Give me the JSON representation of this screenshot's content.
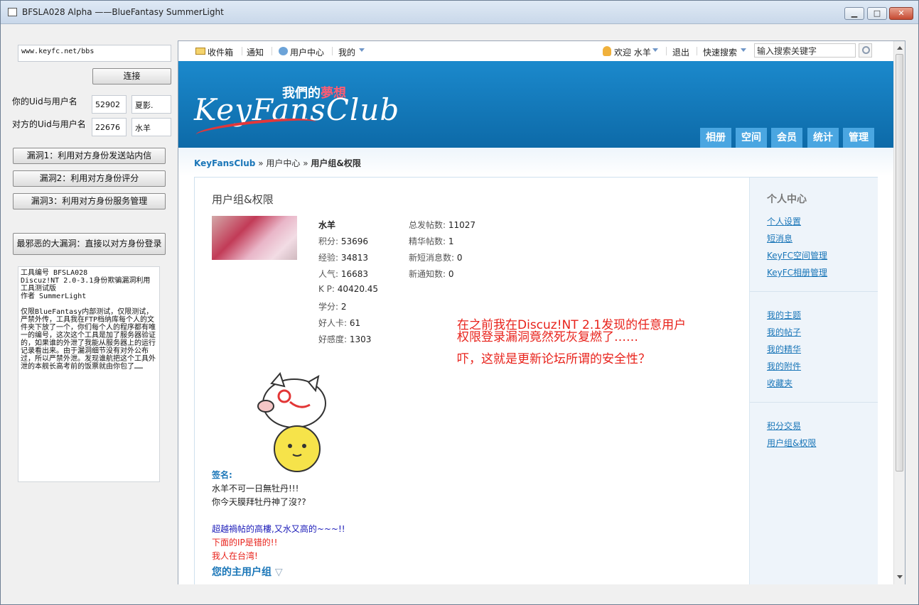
{
  "window": {
    "title": "BFSLA028 Alpha ——BlueFantasy SummerLight",
    "buttons": {
      "min": "▁",
      "max": "□",
      "close": "✕"
    }
  },
  "tool": {
    "url_value": "www.keyfc.net/bbs",
    "connect_label": "连接",
    "my_label": "你的Uid与用户名",
    "my_uid": "52902",
    "my_name": "夏影.",
    "other_label": "对方的Uid与用户名",
    "other_uid": "22676",
    "other_name": "水羊",
    "exploit1": "漏洞1：利用对方身份发送站内信",
    "exploit2": "漏洞2：利用对方身份评分",
    "exploit3": "漏洞3：利用对方身份服务管理",
    "exploit4": "最邪恶的大漏洞：直接以对方身份登录",
    "notes": "工具编号 BFSLA028\nDiscuz!NT 2.0-3.1身份欺骗漏洞利用工具测试版\n作者 SummerLight\n\n仅限BlueFantasy内部测试，仅限测试，严禁外传，工具我在FTP档纳库每个人的文件夹下放了一个，你们每个人的程序都有唯一的编号，这次这个工具是加了服务器验证的，如果谁的外泄了我能从服务器上的运行记录看出来。由于漏洞细节没有对外公布过，所以严禁外泄。发现谁航把这个工具外泄的本舰长高考前的饭票就由你包了……"
  },
  "forum": {
    "topbar": {
      "inbox": "收件箱",
      "notice": "通知",
      "user_center": "用户中心",
      "mine": "我的",
      "welcome": "欢迎 水羊",
      "logout": "退出",
      "quick_search": "快速搜索",
      "search_placeholder": "输入搜索关键字"
    },
    "banner": {
      "logo": "KeyFansClub",
      "slogan_a": "我們的",
      "slogan_b": "夢想",
      "tabs": [
        "相册",
        "空间",
        "会员",
        "统计",
        "管理"
      ]
    },
    "breadcrumb": {
      "home": "KeyFansClub",
      "sep": "»",
      "mid": "用户中心",
      "current": "用户组&权限"
    },
    "page_title": "用户组&权限",
    "profile": {
      "name": "水羊",
      "stats_left": [
        {
          "label": "积分:",
          "value": "53696"
        },
        {
          "label": "经验:",
          "value": "34813"
        },
        {
          "label": "人气:",
          "value": "16683"
        },
        {
          "label": "K P:",
          "value": "40420.45"
        },
        {
          "label": "学分:",
          "value": "2"
        },
        {
          "label": "好人卡:",
          "value": "61"
        },
        {
          "label": "好感度:",
          "value": "1303"
        }
      ],
      "stats_right": [
        {
          "label": "总发帖数:",
          "value": "11027"
        },
        {
          "label": "精华帖数:",
          "value": "1"
        },
        {
          "label": "新短消息数:",
          "value": "0"
        },
        {
          "label": "新通知数:",
          "value": "0"
        }
      ]
    },
    "promo": {
      "line1": "在之前我在Discuz!NT 2.1发现的任意用户",
      "line2": "权限登录漏洞竟然死灰复燃了……",
      "line3": "吓，这就是更新论坛所谓的安全性？"
    },
    "signature": {
      "title": "签名:",
      "l1": "水羊不可一日無牡丹!!!",
      "l2": "你今天膜拜牡丹神了沒??",
      "l3": "超越禍帖的高樓,又水又高的~~~!!",
      "l4": "下面的IP是错的!!",
      "l5": "我人在台湾!"
    },
    "group_title": "您的主用户组",
    "sidebar": {
      "title": "个人中心",
      "group1": [
        "个人设置",
        "短消息",
        "KeyFC空间管理",
        "KeyFC相册管理"
      ],
      "group2": [
        "我的主题",
        "我的帖子",
        "我的精华",
        "我的附件",
        "收藏夹"
      ],
      "group3": [
        "积分交易",
        "用户组&权限"
      ]
    }
  },
  "colors": {
    "accent": "#1a76b8",
    "banner": "#1177bb",
    "promo": "#e8221b",
    "tab": "#4aa6e1",
    "sig_blue": "#1a1ab8",
    "sig_red": "#e8221b"
  }
}
